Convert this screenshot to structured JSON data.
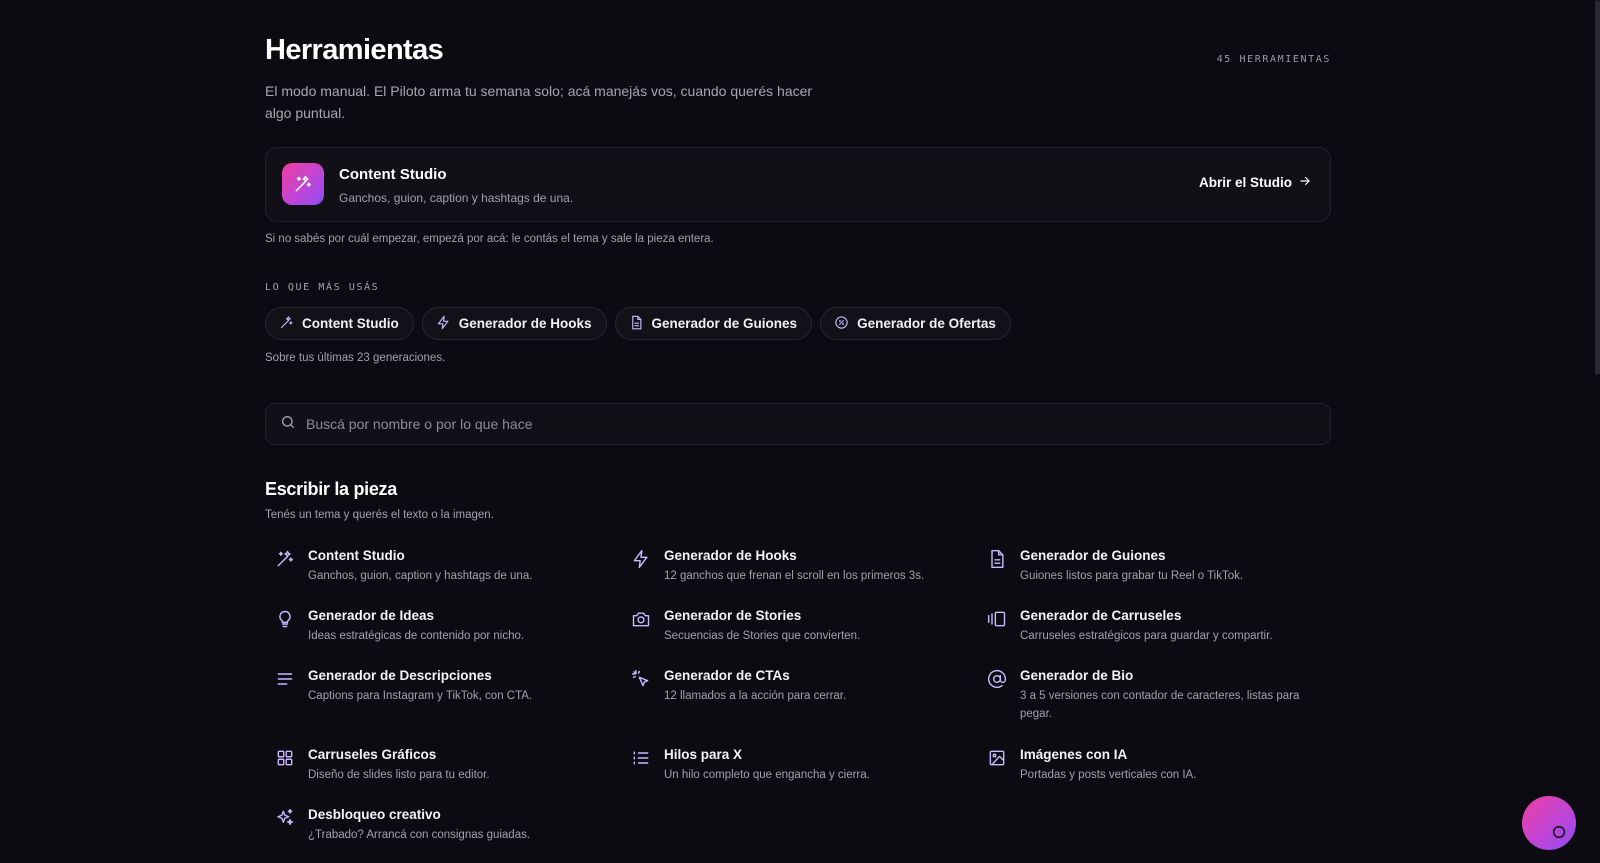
{
  "header": {
    "title": "Herramientas",
    "tool_count": "45 HERRAMIENTAS",
    "subtitle": "El modo manual. El Piloto arma tu semana solo; acá manejás vos, cuando querés hacer algo puntual."
  },
  "featured": {
    "name": "Content Studio",
    "description": "Ganchos, guion, caption y hashtags de una.",
    "open_label": "Abrir el Studio",
    "hint": "Si no sabés por cuál empezar, empezá por acá: le contás el tema y sale la pieza entera."
  },
  "most_used": {
    "label": "LO QUE MÁS USÁS",
    "chips": [
      {
        "label": "Content Studio",
        "icon": "magic-wand-icon"
      },
      {
        "label": "Generador de Hooks",
        "icon": "lightning-icon"
      },
      {
        "label": "Generador de Guiones",
        "icon": "document-icon"
      },
      {
        "label": "Generador de Ofertas",
        "icon": "discount-badge-icon"
      }
    ],
    "note": "Sobre tus últimas 23 generaciones."
  },
  "search": {
    "placeholder": "Buscá por nombre o por lo que hace",
    "value": ""
  },
  "category": {
    "title": "Escribir la pieza",
    "description": "Tenés un tema y querés el texto o la imagen.",
    "tools": [
      {
        "name": "Content Studio",
        "description": "Ganchos, guion, caption y hashtags de una.",
        "icon": "magic-wand-icon"
      },
      {
        "name": "Generador de Hooks",
        "description": "12 ganchos que frenan el scroll en los primeros 3s.",
        "icon": "lightning-icon"
      },
      {
        "name": "Generador de Guiones",
        "description": "Guiones listos para grabar tu Reel o TikTok.",
        "icon": "document-icon"
      },
      {
        "name": "Generador de Ideas",
        "description": "Ideas estratégicas de contenido por nicho.",
        "icon": "lightbulb-icon"
      },
      {
        "name": "Generador de Stories",
        "description": "Secuencias de Stories que convierten.",
        "icon": "camera-icon"
      },
      {
        "name": "Generador de Carruseles",
        "description": "Carruseles estratégicos para guardar y compartir.",
        "icon": "carousel-icon"
      },
      {
        "name": "Generador de Descripciones",
        "description": "Captions para Instagram y TikTok, con CTA.",
        "icon": "text-lines-icon"
      },
      {
        "name": "Generador de CTAs",
        "description": "12 llamados a la acción para cerrar.",
        "icon": "cursor-click-icon"
      },
      {
        "name": "Generador de Bio",
        "description": "3 a 5 versiones con contador de caracteres, listas para pegar.",
        "icon": "at-sign-icon"
      },
      {
        "name": "Carruseles Gráficos",
        "description": "Diseño de slides listo para tu editor.",
        "icon": "grid-icon"
      },
      {
        "name": "Hilos para X",
        "description": "Un hilo completo que engancha y cierra.",
        "icon": "list-icon"
      },
      {
        "name": "Imágenes con IA",
        "description": "Portadas y posts verticales con IA.",
        "icon": "image-icon"
      },
      {
        "name": "Desbloqueo creativo",
        "description": "¿Trabado? Arrancá con consignas guiadas.",
        "icon": "sparkles-icon"
      }
    ]
  },
  "colors": {
    "background": "#0d0b12",
    "accent_pink": "#ee3f9e",
    "accent_purple": "#8c4bf0",
    "icon_lavender": "#c9b8ff"
  }
}
